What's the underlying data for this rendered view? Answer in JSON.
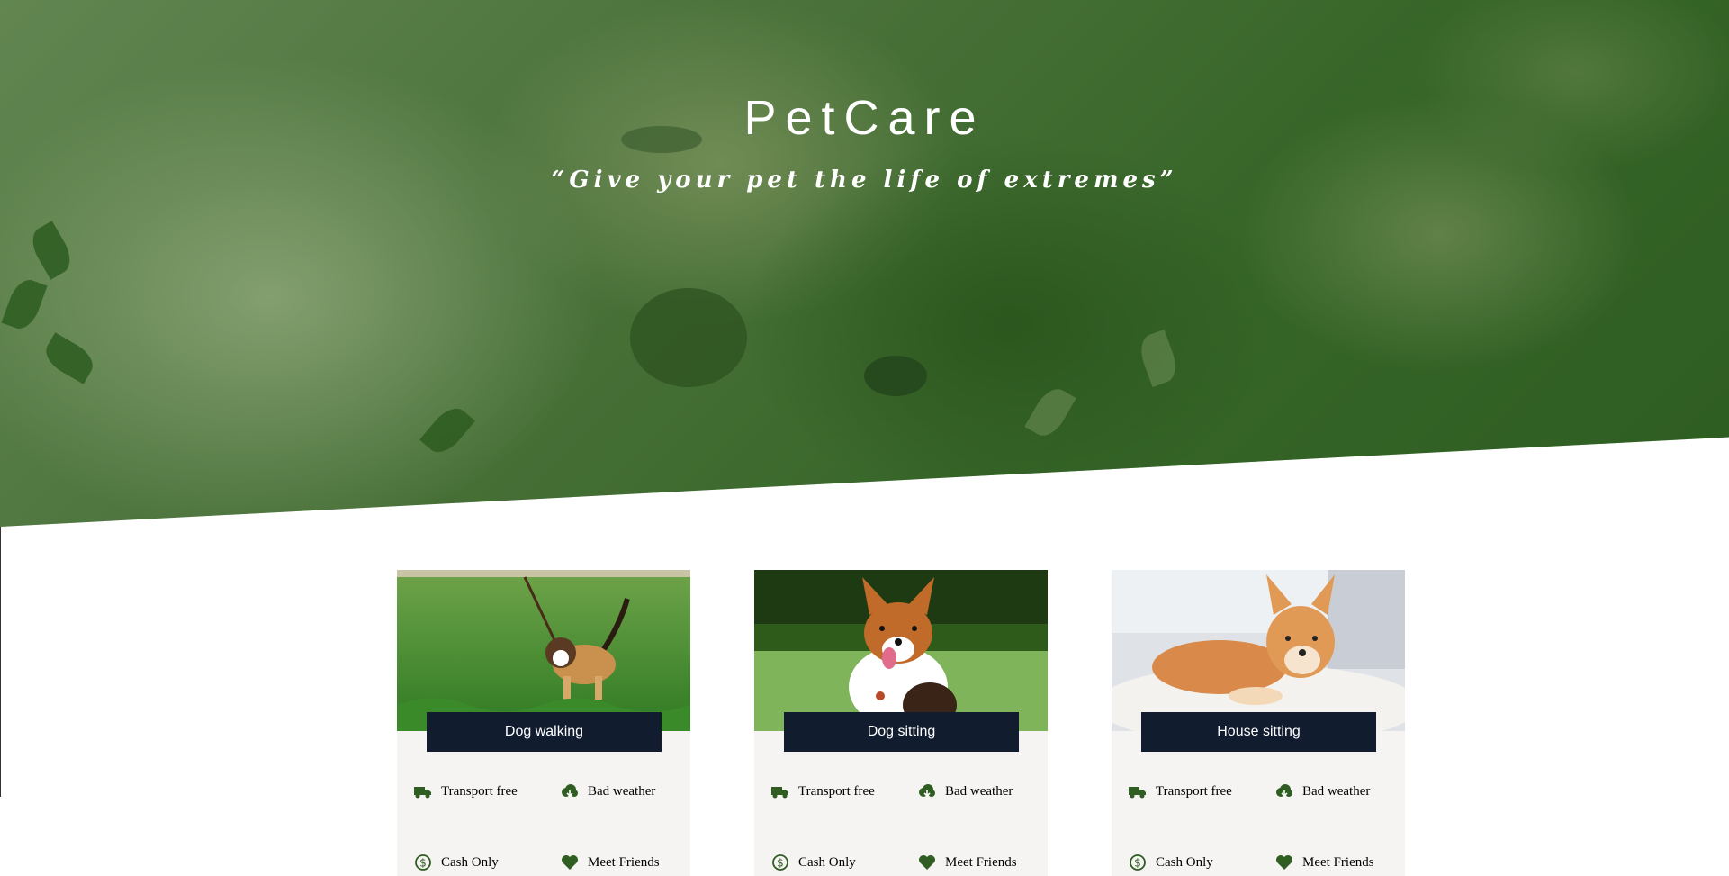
{
  "hero": {
    "title": "PetCare",
    "tagline": "“Give your pet the life of extremes”"
  },
  "colors": {
    "accent_green": "#2f5d22",
    "label_bg": "#111c2e",
    "card_bg": "#f6f4f2"
  },
  "services": [
    {
      "label": "Dog walking",
      "features": [
        {
          "icon": "truck-icon",
          "text": "Transport free"
        },
        {
          "icon": "cloud-icon",
          "text": "Bad weather"
        },
        {
          "icon": "dollar-icon",
          "text": "Cash Only"
        },
        {
          "icon": "heart-icon",
          "text": "Meet Friends"
        }
      ]
    },
    {
      "label": "Dog sitting",
      "features": [
        {
          "icon": "truck-icon",
          "text": "Transport free"
        },
        {
          "icon": "cloud-icon",
          "text": "Bad weather"
        },
        {
          "icon": "dollar-icon",
          "text": "Cash Only"
        },
        {
          "icon": "heart-icon",
          "text": "Meet Friends"
        }
      ]
    },
    {
      "label": "House sitting",
      "features": [
        {
          "icon": "truck-icon",
          "text": "Transport free"
        },
        {
          "icon": "cloud-icon",
          "text": "Bad weather"
        },
        {
          "icon": "dollar-icon",
          "text": "Cash Only"
        },
        {
          "icon": "heart-icon",
          "text": "Meet Friends"
        }
      ]
    }
  ]
}
